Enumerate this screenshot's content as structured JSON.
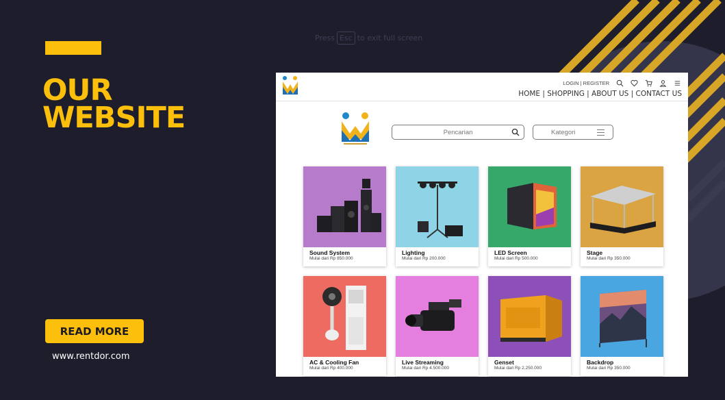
{
  "slide": {
    "headline_line1": "OUR",
    "headline_line2": "WEBSITE",
    "read_more_label": "READ MORE",
    "website_url": "www.rentdor.com",
    "fullscreen_hint_pre": "Press",
    "fullscreen_hint_key": "Esc",
    "fullscreen_hint_post": "to exit full screen"
  },
  "colors": {
    "background": "#1d1d2c",
    "accent": "#fcbf0c"
  },
  "site": {
    "top_links": "LOGIN | REGISTER",
    "icons": [
      "search-icon",
      "heart-icon",
      "cart-icon",
      "user-icon",
      "menu-icon"
    ],
    "nav": "HOME | SHOPPING | ABOUT US | CONTACT US",
    "search_placeholder": "Pencarian",
    "category_label": "Kategori",
    "products": [
      {
        "name": "Sound System",
        "price": "Mulai dari Rp 850.000",
        "bg": "#b77bcb"
      },
      {
        "name": "Lighting",
        "price": "Mulai dari Rp 200.000",
        "bg": "#8fd3e6"
      },
      {
        "name": "LED Screen",
        "price": "Mulai dari Rp 500.000",
        "bg": "#35a86a"
      },
      {
        "name": "Stage",
        "price": "Mulai dari Rp 350.000",
        "bg": "#d9a441"
      },
      {
        "name": "AC & Cooling Fan",
        "price": "Mulai dari Rp 400.000",
        "bg": "#ee6b62"
      },
      {
        "name": "Live Streaming",
        "price": "Mulai dari Rp 4.500.000",
        "bg": "#e57fdf"
      },
      {
        "name": "Genset",
        "price": "Mulai dari Rp 2.250.000",
        "bg": "#8d4fb8"
      },
      {
        "name": "Backdrop",
        "price": "Mulai dari Rp 350.000",
        "bg": "#4aa6e0"
      }
    ]
  }
}
